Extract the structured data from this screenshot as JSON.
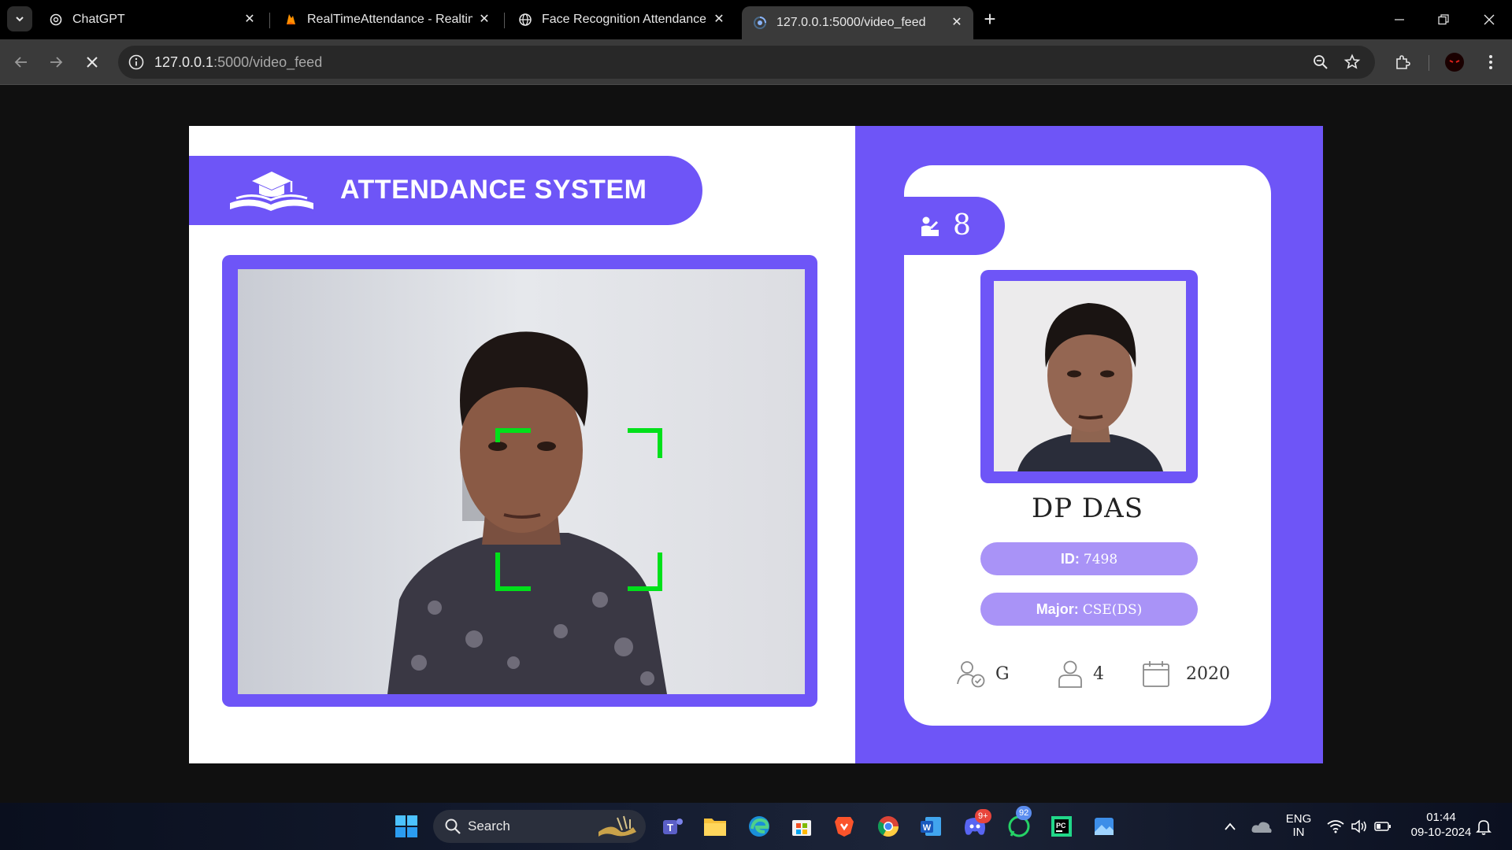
{
  "browser": {
    "tabs": [
      {
        "title": "ChatGPT",
        "active": false
      },
      {
        "title": "RealTimeAttendance - Realtime",
        "active": false
      },
      {
        "title": "Face Recognition Attendance Sy",
        "active": false
      },
      {
        "title": "127.0.0.1:5000/video_feed",
        "active": true
      }
    ],
    "url_host": "127.0.0.1",
    "url_path": ":5000/video_feed"
  },
  "app": {
    "header_title": "ATTENDANCE SYSTEM",
    "attendance_count": "8",
    "student": {
      "name": "DP  DAS",
      "id_label": "ID:",
      "id_value": "7498",
      "major_label": "Major:",
      "major_value": "CSE(DS)",
      "standing": "G",
      "year": "4",
      "starting_year": "2020"
    },
    "colors": {
      "accent": "#6e55f7",
      "pill_light": "#a993f7",
      "face_box": "#00e01a"
    }
  },
  "taskbar": {
    "search_label": "Search",
    "lang_top": "ENG",
    "lang_bottom": "IN",
    "time": "01:44",
    "date": "09-10-2024",
    "discord_badge": "9+",
    "whatsapp_badge": "92"
  }
}
